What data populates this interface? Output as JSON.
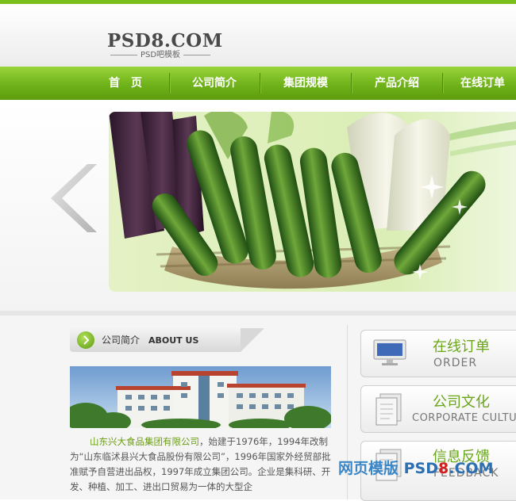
{
  "logo": {
    "main": "PSD8.COM",
    "sub": "PSD吧模板"
  },
  "nav": {
    "items": [
      "首　页",
      "公司简介",
      "集团规模",
      "产品介绍",
      "在线订单"
    ]
  },
  "about": {
    "title_cn": "公司简介",
    "title_en": "ABOUT US"
  },
  "intro": {
    "company": "山东兴大食品集团有限公司",
    "text": "，始建于1976年，1994年改制为“山东临沭县兴大食品股份有限公司”，1996年国家外经贸部批准赋予自营进出品权，1997年成立集团公司。企业是集科研、开发、种植、加工、进出口贸易为一体的大型企"
  },
  "sidebar": {
    "buttons": [
      {
        "cn": "在线订单",
        "en": "ORDER"
      },
      {
        "cn": "公司文化",
        "en": "CORPORATE CULTURE"
      },
      {
        "cn": "信息反馈",
        "en": "FEEDBACK"
      }
    ]
  },
  "watermark": {
    "part1": "网页模版 ",
    "part2": "PSD",
    "part3": "8",
    "part4": ".COM"
  },
  "colors": {
    "brand_green": "#7bbf1d",
    "nav_green": "#6fb21a",
    "link_green": "#6a9e12",
    "watermark_blue": "#3b86c6",
    "watermark_red": "#d11f1f"
  },
  "icons": [
    "arrow-left-icon",
    "arrow-right-circle-icon",
    "monitor-icon",
    "document-icon"
  ]
}
